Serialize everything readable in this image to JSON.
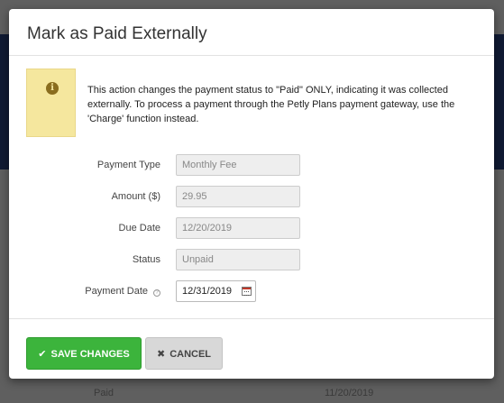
{
  "background": {
    "row_status": "Paid",
    "row_date": "11/20/2019"
  },
  "modal": {
    "title": "Mark as Paid Externally",
    "info_icon": "info-icon",
    "info_text": "This action changes the payment status to \"Paid\" ONLY, indicating it was collected externally. To process a payment through the Petly Plans payment gateway, use the 'Charge' function instead.",
    "fields": {
      "payment_type": {
        "label": "Payment Type",
        "value": "Monthly Fee"
      },
      "amount": {
        "label": "Amount ($)",
        "value": "29.95"
      },
      "due_date": {
        "label": "Due Date",
        "value": "12/20/2019"
      },
      "status": {
        "label": "Status",
        "value": "Unpaid"
      },
      "payment_date": {
        "label": "Payment Date",
        "value": "12/31/2019",
        "help_icon": "question-circle-icon",
        "picker_icon": "calendar-icon"
      }
    },
    "footer": {
      "save_label": "SAVE CHANGES",
      "cancel_label": "CANCEL"
    }
  },
  "colors": {
    "save_button": "#3cb43c",
    "info_box": "#f5e79e",
    "overlay_header": "#101a33"
  }
}
